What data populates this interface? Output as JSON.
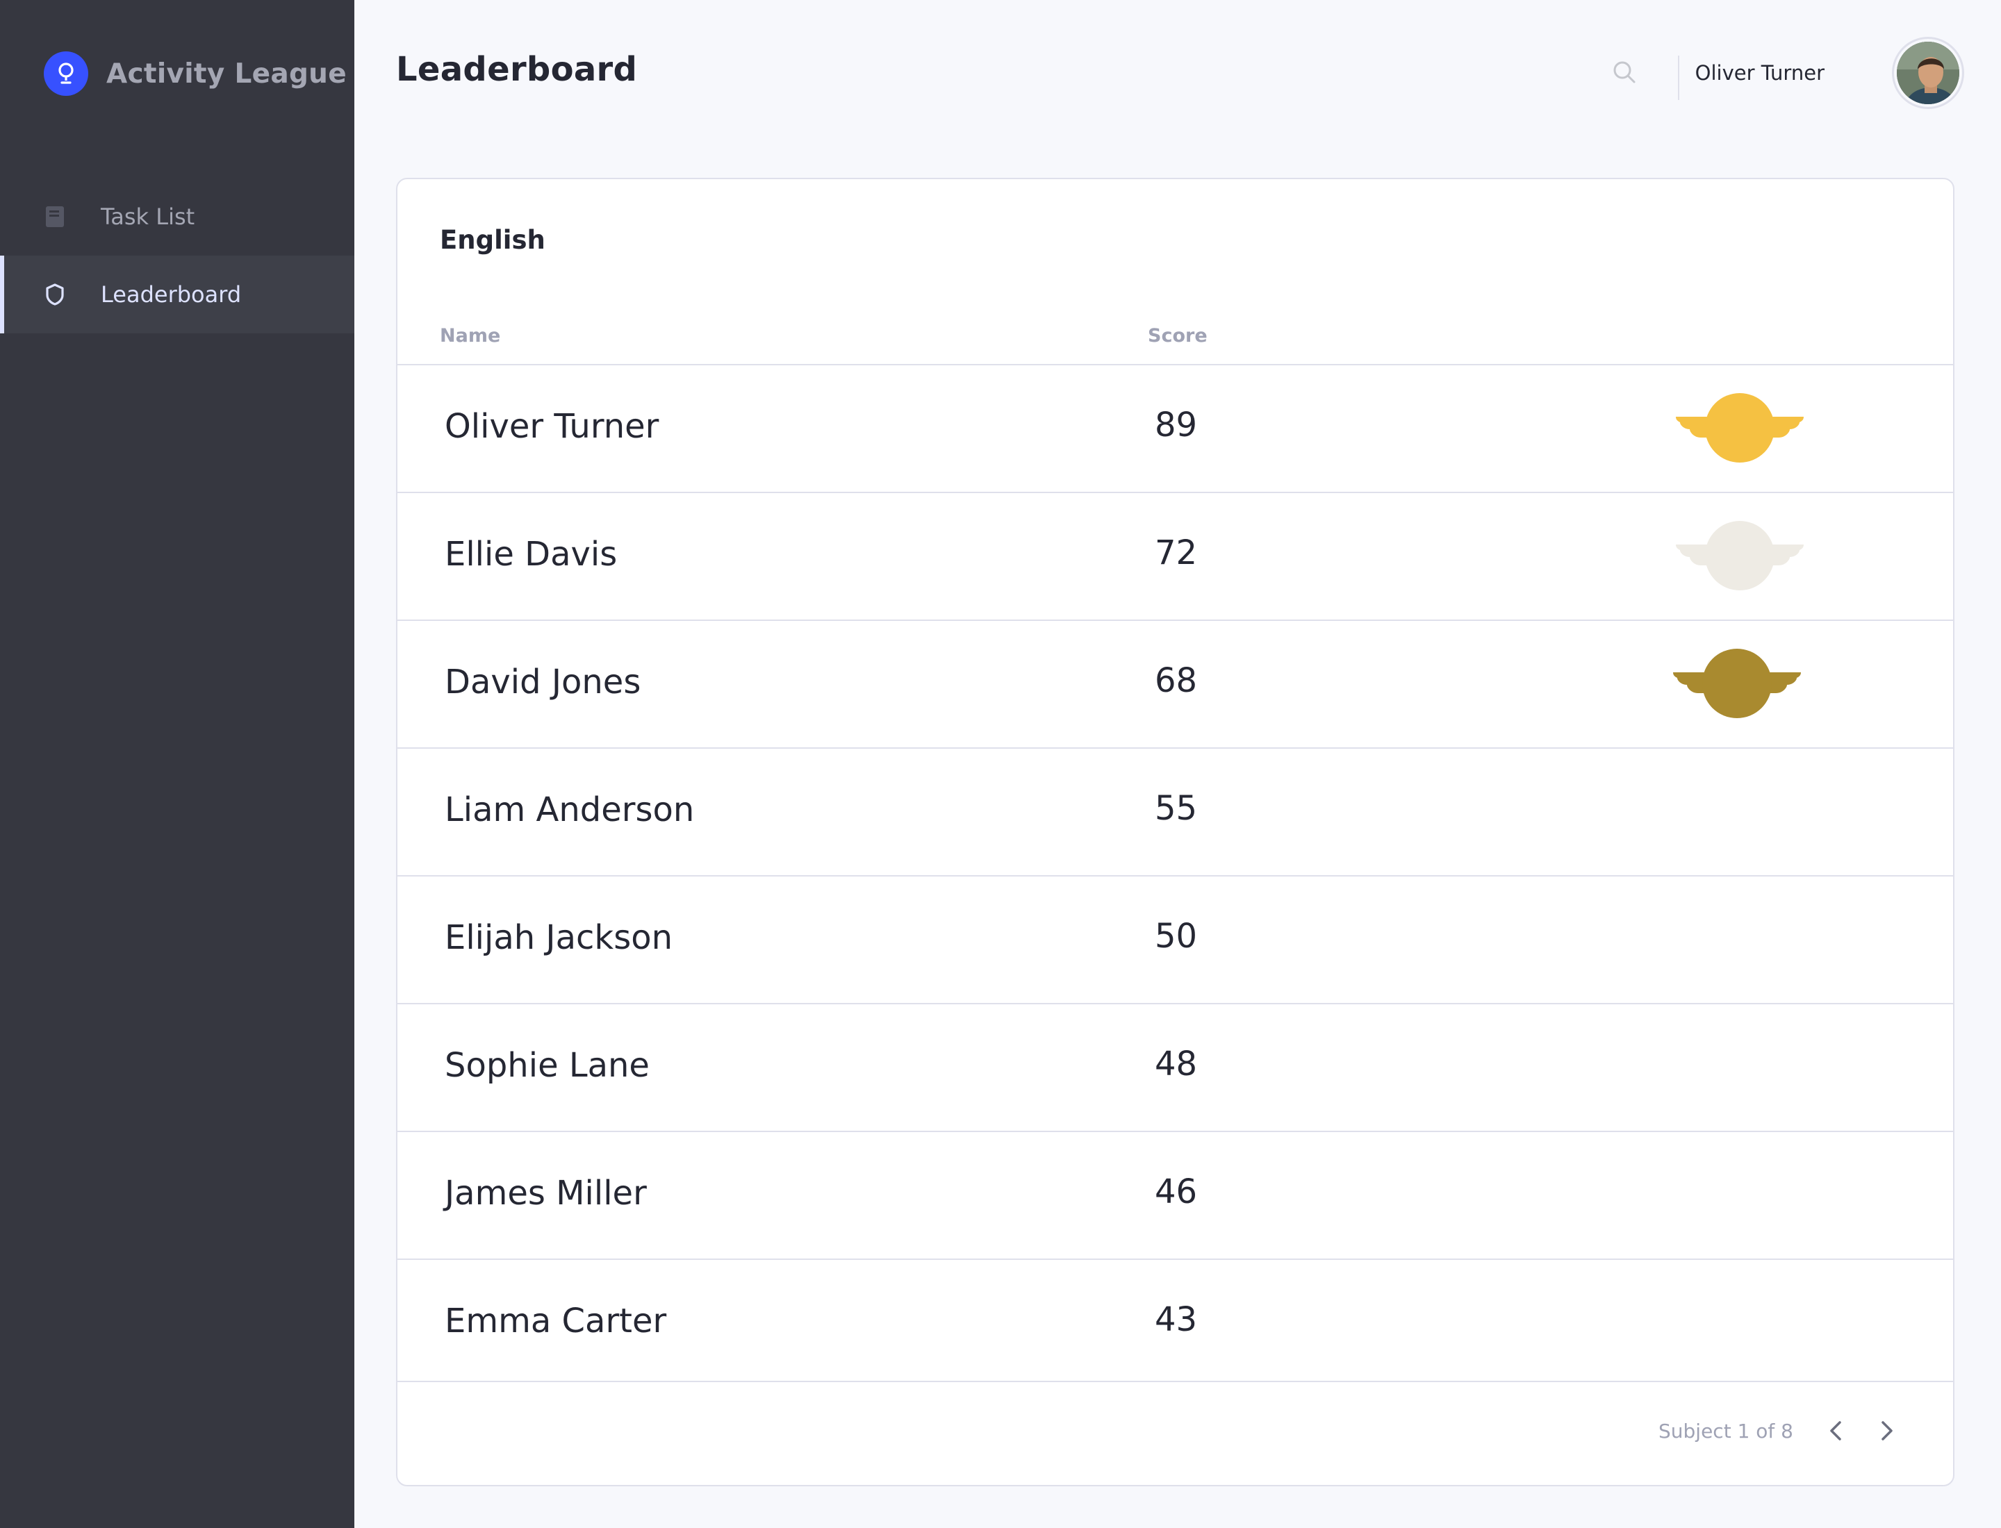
{
  "app": {
    "name": "Activity League",
    "accent": "#3751ff"
  },
  "sidebar": {
    "items": [
      {
        "label": "Task List",
        "icon": "book-icon",
        "active": false
      },
      {
        "label": "Leaderboard",
        "icon": "shield-icon",
        "active": true
      }
    ]
  },
  "header": {
    "title": "Leaderboard",
    "search_icon": "search-icon",
    "user_name": "Oliver Turner"
  },
  "leaderboard": {
    "subject": "English",
    "columns": {
      "name": "Name",
      "score": "Score"
    },
    "rows": [
      {
        "name": "Oliver Turner",
        "score": "89",
        "medal": "gold-medal-icon",
        "medal_color": "#f5c142"
      },
      {
        "name": "Ellie Davis",
        "score": "72",
        "medal": "silver-medal-icon",
        "medal_color": "#eeebe4"
      },
      {
        "name": "David Jones",
        "score": "68",
        "medal": "bronze-medal-icon",
        "medal_color": "#a98a2f"
      },
      {
        "name": "Liam Anderson",
        "score": "55"
      },
      {
        "name": "Elijah Jackson",
        "score": "50"
      },
      {
        "name": "Sophie Lane",
        "score": "48"
      },
      {
        "name": "James Miller",
        "score": "46"
      },
      {
        "name": "Emma Carter",
        "score": "43"
      }
    ],
    "pagination": {
      "text": "Subject 1 of 8"
    }
  }
}
